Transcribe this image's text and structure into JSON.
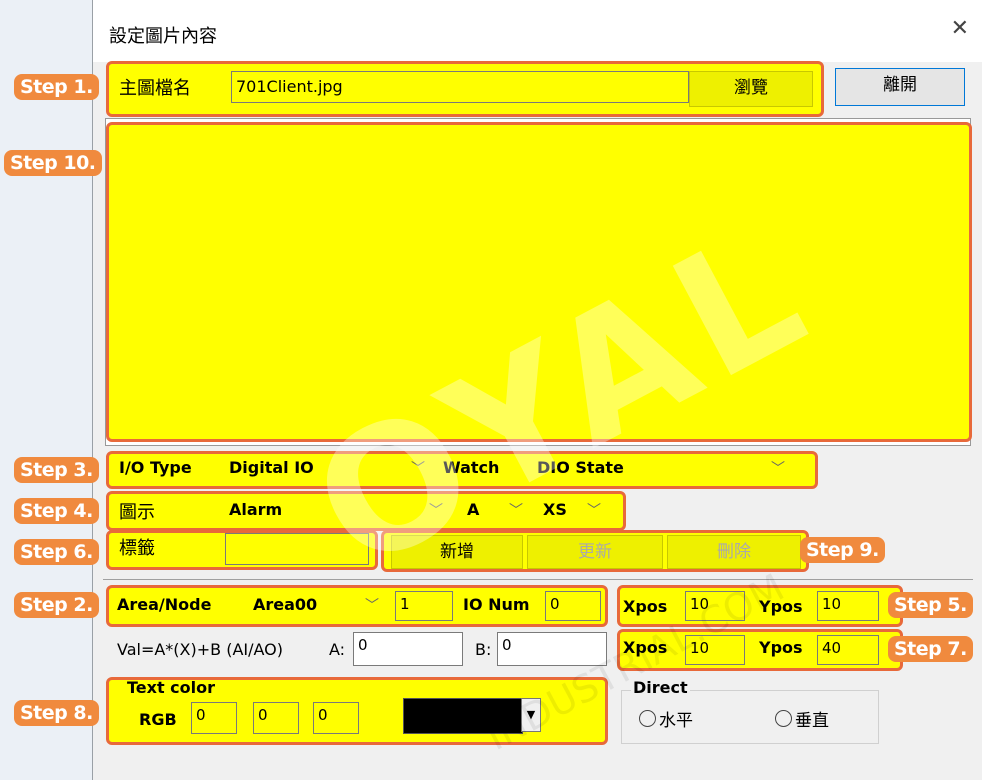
{
  "dialog": {
    "title": "設定圖片內容",
    "close_icon": "close-icon"
  },
  "steps": {
    "s1": "Step 1.",
    "s2": "Step 2.",
    "s3": "Step 3.",
    "s4": "Step 4.",
    "s5": "Step 5.",
    "s6": "Step 6.",
    "s7": "Step 7.",
    "s8": "Step 8.",
    "s9": "Step 9.",
    "s10": "Step 10."
  },
  "file": {
    "label": "主圖檔名",
    "value": "701Client.jpg",
    "browse": "瀏覽",
    "exit": "離開"
  },
  "io": {
    "type_label": "I/O Type",
    "type_value": "Digital IO",
    "watch_label": "Watch",
    "watch_value": "DIO State"
  },
  "icon": {
    "label": "圖示",
    "value": "Alarm",
    "letter": "A",
    "size": "XS"
  },
  "tag": {
    "label": "標籤",
    "value": ""
  },
  "actions": {
    "add": "新增",
    "update": "更新",
    "delete": "刪除"
  },
  "area": {
    "label": "Area/Node",
    "value": "Area00",
    "node": "1",
    "io_num_label": "IO Num",
    "io_num": "0"
  },
  "pos1": {
    "xlabel": "Xpos",
    "x": "10",
    "ylabel": "Ypos",
    "y": "10"
  },
  "pos2": {
    "xlabel": "Xpos",
    "x": "10",
    "ylabel": "Ypos",
    "y": "40"
  },
  "formula": {
    "label": "Val=A*(X)+B (AI/AO)",
    "a_label": "A:",
    "a": "0",
    "b_label": "B:",
    "b": "0"
  },
  "textcolor": {
    "label": "Text color",
    "rgb_label": "RGB",
    "r": "0",
    "g": "0",
    "b": "0",
    "swatch": "#000000"
  },
  "direct": {
    "label": "Direct",
    "horizontal": "水平",
    "vertical": "垂直"
  },
  "watermark": "OYAL",
  "watermark2": "INDUSTRIAL.COM"
}
